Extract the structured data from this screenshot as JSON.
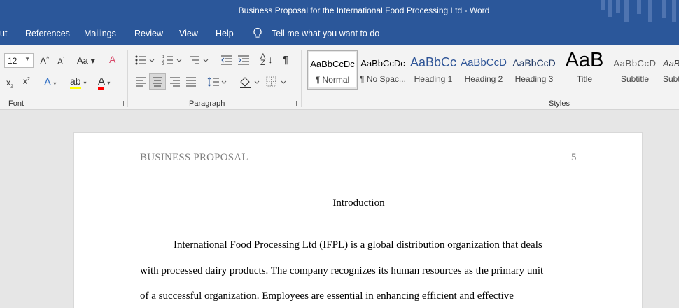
{
  "window": {
    "title": "Business Proposal for the International Food Processing Ltd  -  Word"
  },
  "menu": {
    "tabs": [
      "ut",
      "References",
      "Mailings",
      "Review",
      "View",
      "Help"
    ],
    "tell_me": "Tell me what you want to do"
  },
  "ribbon": {
    "font": {
      "size": "12",
      "group_label": "Font"
    },
    "paragraph": {
      "group_label": "Paragraph"
    },
    "styles": {
      "group_label": "Styles",
      "items": [
        {
          "preview": "AaBbCcDc",
          "name": "¶ Normal"
        },
        {
          "preview": "AaBbCcDc",
          "name": "¶ No Spac..."
        },
        {
          "preview": "AaBbCc",
          "name": "Heading 1"
        },
        {
          "preview": "AaBbCcD",
          "name": "Heading 2"
        },
        {
          "preview": "AaBbCcD",
          "name": "Heading 3"
        },
        {
          "preview": "AaB",
          "name": "Title"
        },
        {
          "preview": "AaBbCcD",
          "name": "Subtitle"
        },
        {
          "preview": "AaBl",
          "name": "Subt"
        }
      ]
    },
    "colors": {
      "accent": "#2b579a",
      "highlight": "#ffff00",
      "font_color": "#ff0000"
    }
  },
  "document": {
    "header_left": "BUSINESS PROPOSAL",
    "page_number": "5",
    "title": "Introduction",
    "lines": [
      "International Food Processing Ltd (IFPL) is a global distribution organization that deals",
      "with processed dairy products. The company recognizes its human resources as the primary unit",
      "of a successful organization. Employees are essential in enhancing efficient and effective"
    ]
  }
}
